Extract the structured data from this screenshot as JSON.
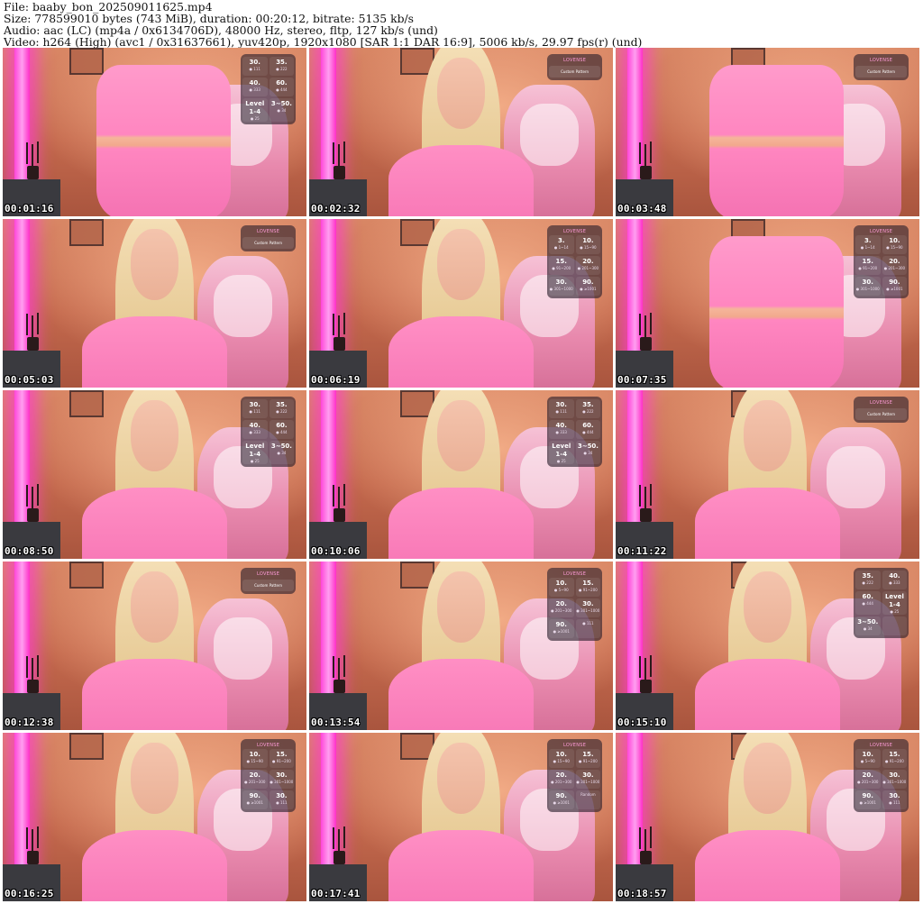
{
  "header": {
    "line1": "File: baaby_bon_202509011625.mp4",
    "line2": "Size: 778599010 bytes (743 MiB), duration: 00:20:12, bitrate: 5135 kb/s",
    "line3": "Audio: aac (LC) (mp4a / 0x6134706D), 48000 Hz, stereo, fltp, 127 kb/s (und)",
    "line4": "Video: h264 (High) (avc1 / 0x31637661), yuv420p, 1920x1080 [SAR 1:1 DAR 16:9], 5006 kb/s, 29.97 fps(r) (und)"
  },
  "thumbnails": [
    {
      "timestamp": "00:01:16",
      "overlay": {
        "kind": "grid",
        "cells": [
          {
            "v": "30.",
            "s": "● 111"
          },
          {
            "v": "35.",
            "s": "● 222"
          },
          {
            "v": "40.",
            "s": "● 333"
          },
          {
            "v": "60.",
            "s": "● 444"
          },
          {
            "v": "Level 1-4",
            "s": "● 25"
          },
          {
            "v": "3~50.",
            "s": "● 34"
          }
        ]
      }
    },
    {
      "timestamp": "00:02:32",
      "overlay": {
        "kind": "pattern",
        "brand": "LOVENSE",
        "label": "Custom Pattern"
      }
    },
    {
      "timestamp": "00:03:48",
      "overlay": {
        "kind": "pattern",
        "brand": "LOVENSE",
        "label": "Custom Pattern"
      }
    },
    {
      "timestamp": "00:05:03",
      "overlay": {
        "kind": "pattern",
        "brand": "LOVENSE",
        "label": "Custom Pattern"
      }
    },
    {
      "timestamp": "00:06:19",
      "overlay": {
        "kind": "grid",
        "brand": "LOVENSE",
        "cells": [
          {
            "v": "3.",
            "s": "● 1~14"
          },
          {
            "v": "10.",
            "s": "● 15~90"
          },
          {
            "v": "15.",
            "s": "● 91~200"
          },
          {
            "v": "20.",
            "s": "● 201~300"
          },
          {
            "v": "30.",
            "s": "● 301~1000"
          },
          {
            "v": "90.",
            "s": "● ≥1001"
          }
        ]
      }
    },
    {
      "timestamp": "00:07:35",
      "overlay": {
        "kind": "grid",
        "brand": "LOVENSE",
        "cells": [
          {
            "v": "3.",
            "s": "● 1~14"
          },
          {
            "v": "10.",
            "s": "● 15~90"
          },
          {
            "v": "15.",
            "s": "● 91~200"
          },
          {
            "v": "20.",
            "s": "● 201~300"
          },
          {
            "v": "30.",
            "s": "● 301~1000"
          },
          {
            "v": "90.",
            "s": "● ≥1001"
          }
        ]
      }
    },
    {
      "timestamp": "00:08:50",
      "overlay": {
        "kind": "grid",
        "cells": [
          {
            "v": "30.",
            "s": "● 111"
          },
          {
            "v": "35.",
            "s": "● 222"
          },
          {
            "v": "40.",
            "s": "● 333"
          },
          {
            "v": "60.",
            "s": "● 444"
          },
          {
            "v": "Level 1-4",
            "s": "● 25"
          },
          {
            "v": "3~50.",
            "s": "● 34"
          }
        ]
      }
    },
    {
      "timestamp": "00:10:06",
      "overlay": {
        "kind": "grid",
        "cells": [
          {
            "v": "30.",
            "s": "● 111"
          },
          {
            "v": "35.",
            "s": "● 222"
          },
          {
            "v": "40.",
            "s": "● 333"
          },
          {
            "v": "60.",
            "s": "● 444"
          },
          {
            "v": "Level 1-4",
            "s": "● 25"
          },
          {
            "v": "3~50.",
            "s": "● 34"
          }
        ]
      }
    },
    {
      "timestamp": "00:11:22",
      "overlay": {
        "kind": "pattern",
        "brand": "LOVENSE",
        "label": "Custom Pattern"
      }
    },
    {
      "timestamp": "00:12:38",
      "overlay": {
        "kind": "pattern",
        "brand": "LOVENSE",
        "label": "Custom Pattern"
      }
    },
    {
      "timestamp": "00:13:54",
      "overlay": {
        "kind": "grid",
        "brand": "LOVENSE",
        "cells": [
          {
            "v": "10.",
            "s": "● 5~90"
          },
          {
            "v": "15.",
            "s": "● 91~200"
          },
          {
            "v": "20.",
            "s": "● 201~300"
          },
          {
            "v": "30.",
            "s": "● 301~1000"
          },
          {
            "v": "90.",
            "s": "● ≥1001"
          },
          {
            "v": "",
            "s": "● 111"
          }
        ]
      }
    },
    {
      "timestamp": "00:15:10",
      "overlay": {
        "kind": "grid",
        "cells": [
          {
            "v": "35.",
            "s": "● 222"
          },
          {
            "v": "40.",
            "s": "● 333"
          },
          {
            "v": "60.",
            "s": "● 444"
          },
          {
            "v": "Level 1-4",
            "s": "● 25"
          },
          {
            "v": "3~50.",
            "s": "● 34"
          },
          {
            "v": "",
            "s": ""
          }
        ]
      }
    },
    {
      "timestamp": "00:16:25",
      "overlay": {
        "kind": "grid",
        "brand": "LOVENSE",
        "cells": [
          {
            "v": "10.",
            "s": "● 15~90"
          },
          {
            "v": "15.",
            "s": "● 91~200"
          },
          {
            "v": "20.",
            "s": "● 201~300"
          },
          {
            "v": "30.",
            "s": "● 301~1000"
          },
          {
            "v": "90.",
            "s": "● ≥1001"
          },
          {
            "v": "30.",
            "s": "● 111"
          }
        ]
      }
    },
    {
      "timestamp": "00:17:41",
      "overlay": {
        "kind": "grid",
        "brand": "LOVENSE",
        "cells": [
          {
            "v": "10.",
            "s": "● 15~90"
          },
          {
            "v": "15.",
            "s": "● 91~200"
          },
          {
            "v": "20.",
            "s": "● 201~300"
          },
          {
            "v": "30.",
            "s": "● 301~1000"
          },
          {
            "v": "90.",
            "s": "● ≥1001"
          },
          {
            "v": "",
            "s": "Random"
          }
        ]
      }
    },
    {
      "timestamp": "00:18:57",
      "overlay": {
        "kind": "grid",
        "brand": "LOVENSE",
        "cells": [
          {
            "v": "10.",
            "s": "● 5~90"
          },
          {
            "v": "15.",
            "s": "● 91~200"
          },
          {
            "v": "20.",
            "s": "● 201~300"
          },
          {
            "v": "30.",
            "s": "● 301~1000"
          },
          {
            "v": "90.",
            "s": "● ≥1001"
          },
          {
            "v": "30.",
            "s": "● 111"
          }
        ]
      }
    }
  ],
  "scenes": [
    "lower",
    "face",
    "lower",
    "face",
    "face",
    "lower",
    "face",
    "face",
    "face",
    "face",
    "face",
    "face",
    "face",
    "face",
    "face"
  ],
  "colors": {
    "neon": "#ff46d9",
    "shirt": "#f776b5",
    "wall": "#d98765",
    "chair": "#e889ad",
    "overlay_brand": "#ff9bd9"
  }
}
